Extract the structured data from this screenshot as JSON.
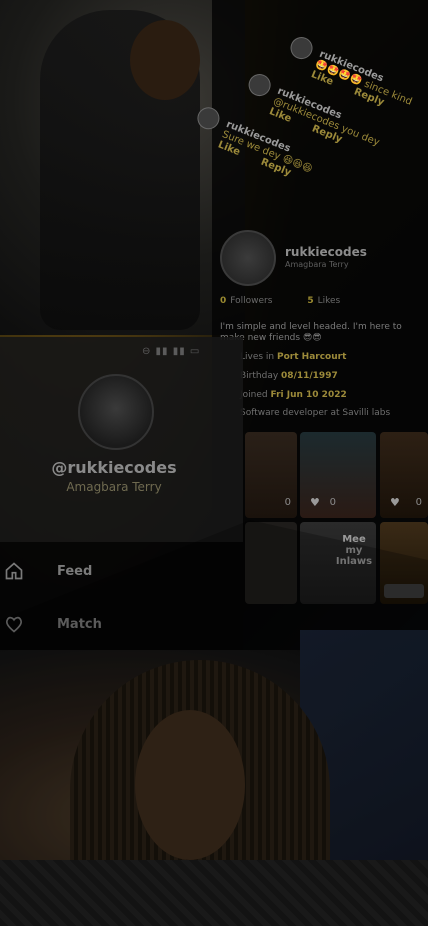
{
  "comments": [
    {
      "user": "rukkiecodes",
      "text": "🤩🤩🤩🤩 since kind",
      "like": "Like",
      "reply": "Reply"
    },
    {
      "user": "rukkiecodes",
      "mention": "@rukkiecodes",
      "text": "you dey",
      "like": "Like",
      "reply": "Reply"
    },
    {
      "user": "rukkiecodes",
      "text": "Sure we dey 😆😆😆",
      "like": "Like",
      "reply": "Reply"
    }
  ],
  "profile": {
    "username": "rukkiecodes",
    "location": "Amagbara Terry",
    "followers_count": "0",
    "followers_label": "Followers",
    "likes_count": "5",
    "likes_label": "Likes",
    "bio": "I'm simple and level headed. I'm here to make new friends 😎😎",
    "lives_label": "Lives in",
    "lives_value": "Port Harcourt",
    "birthday_label": "Birthday",
    "birthday_value": "08/11/1997",
    "joined_label": "Joined",
    "joined_value": "Fri Jun 10 2022",
    "work_text": "Software developer at Savilli labs"
  },
  "grid": {
    "tile1_likes": "0",
    "tile2_likes": "0",
    "tile3_likes": "0",
    "tile5_text": "Mee my Inlaws"
  },
  "card": {
    "handle": "@rukkiecodes",
    "location": "Amagbara Terry"
  },
  "menu": {
    "feed": "Feed",
    "match": "Match"
  },
  "icons": {
    "feed": "home-icon",
    "match": "heart-icon"
  },
  "colors": {
    "accent": "#c8a22a",
    "background": "#0a0a0a"
  }
}
